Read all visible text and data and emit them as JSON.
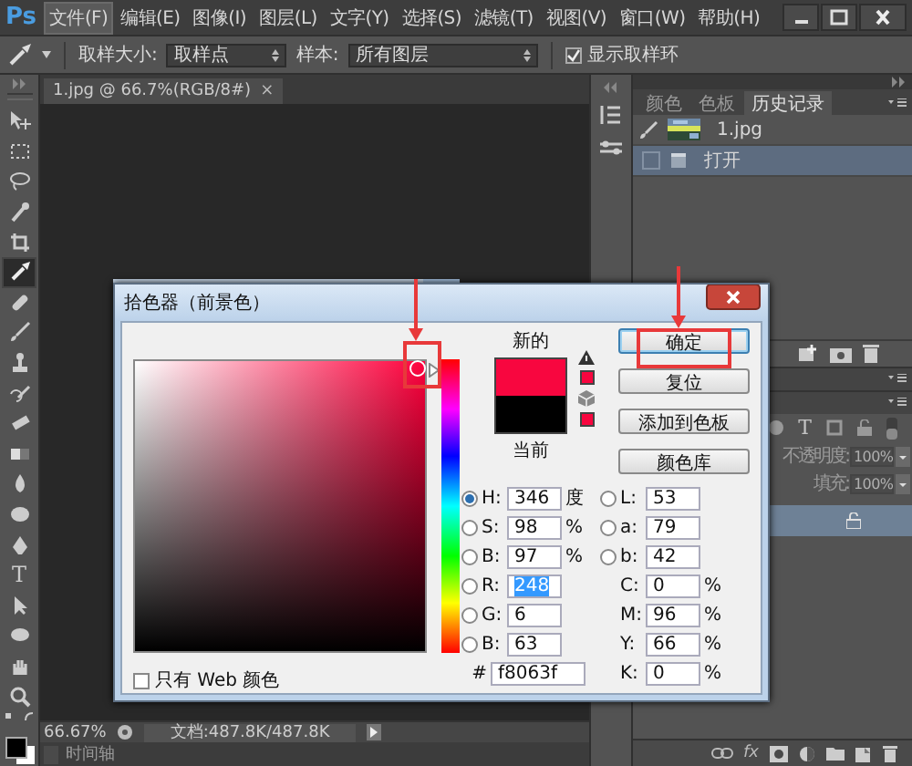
{
  "app": {
    "logo": "Ps"
  },
  "menu": [
    {
      "label": "文件(F)",
      "selected": true
    },
    {
      "label": "编辑(E)",
      "selected": false
    },
    {
      "label": "图像(I)",
      "selected": false
    },
    {
      "label": "图层(L)",
      "selected": false
    },
    {
      "label": "文字(Y)",
      "selected": false
    },
    {
      "label": "选择(S)",
      "selected": false
    },
    {
      "label": "滤镜(T)",
      "selected": false
    },
    {
      "label": "视图(V)",
      "selected": false
    },
    {
      "label": "窗口(W)",
      "selected": false
    },
    {
      "label": "帮助(H)",
      "selected": false
    }
  ],
  "options_bar": {
    "sample_size_label": "取样大小:",
    "sample_size": "取样点",
    "sample_label": "样本:",
    "sample": "所有图层",
    "show_ring": {
      "label": "显示取样环",
      "checked": true
    }
  },
  "tools": [
    {
      "kind": "move",
      "selected": false
    },
    {
      "kind": "marquee",
      "selected": false
    },
    {
      "kind": "lasso",
      "selected": false
    },
    {
      "kind": "quick-select",
      "selected": false
    },
    {
      "kind": "crop",
      "selected": false
    },
    {
      "kind": "eyedropper",
      "selected": true
    },
    {
      "kind": "healing",
      "selected": false
    },
    {
      "kind": "brush",
      "selected": false
    },
    {
      "kind": "stamp",
      "selected": false
    },
    {
      "kind": "history-brush",
      "selected": false
    },
    {
      "kind": "eraser",
      "selected": false
    },
    {
      "kind": "gradient",
      "selected": false
    },
    {
      "kind": "blur",
      "selected": false
    },
    {
      "kind": "dodge",
      "selected": false
    },
    {
      "kind": "pen",
      "selected": false
    },
    {
      "kind": "type",
      "glyph": "T",
      "selected": false
    },
    {
      "kind": "path-select",
      "selected": false
    },
    {
      "kind": "shape",
      "selected": false
    },
    {
      "kind": "hand",
      "selected": false
    },
    {
      "kind": "zoom",
      "selected": false
    }
  ],
  "document_tab": {
    "title": "1.jpg @ 66.7%(RGB/8#)",
    "close": "×"
  },
  "status_bar": {
    "zoom": "66.67%",
    "doc_info": "文档:487.8K/487.8K",
    "timeline": "时间轴"
  },
  "panel_tabs": [
    {
      "label": "颜色",
      "selected": false
    },
    {
      "label": "色板",
      "selected": false
    },
    {
      "label": "历史记录",
      "selected": true
    }
  ],
  "history": [
    {
      "kind": "snapshot",
      "label": "1.jpg",
      "selected": false
    },
    {
      "kind": "step",
      "label": "打开",
      "selected": true
    }
  ],
  "layers": {
    "filter_glyph": "T",
    "filter_toggle": {
      "on": false
    },
    "opacity_label": "不透明度:",
    "opacity": "100%",
    "fill_label": "填充:",
    "fill": "100%",
    "disabled": true,
    "footer_fx": "fx"
  },
  "dialog": {
    "title": "拾色器（前景色）",
    "hue_slider": {
      "level": 0.961
    },
    "swatches": [
      {
        "label": "新的",
        "color": "#f8063f"
      },
      {
        "label": "当前",
        "color": "#000000"
      }
    ],
    "buttons": [
      {
        "label": "确定",
        "default": true
      },
      {
        "label": "复位",
        "default": false
      },
      {
        "label": "添加到色板",
        "default": false
      },
      {
        "label": "颜色库",
        "default": false
      }
    ],
    "fields_left": [
      {
        "kind": "radio",
        "label": "H:",
        "value": "346",
        "unit": "度",
        "selected": true,
        "text_selected": false
      },
      {
        "kind": "radio",
        "label": "S:",
        "value": "98",
        "unit": "%",
        "selected": false,
        "text_selected": false
      },
      {
        "kind": "radio",
        "label": "B:",
        "value": "97",
        "unit": "%",
        "selected": false,
        "text_selected": false
      },
      {
        "kind": "radio",
        "label": "R:",
        "value": "248",
        "selected": false,
        "text_selected": true
      },
      {
        "kind": "radio",
        "label": "G:",
        "value": "6",
        "selected": false,
        "text_selected": false
      },
      {
        "kind": "radio",
        "label": "B:",
        "value": "63",
        "selected": false,
        "text_selected": false
      }
    ],
    "fields_right": [
      {
        "kind": "radio",
        "label": "L:",
        "value": "53",
        "selected": false,
        "text_selected": false
      },
      {
        "kind": "radio",
        "label": "a:",
        "value": "79",
        "selected": false,
        "text_selected": false
      },
      {
        "kind": "radio",
        "label": "b:",
        "value": "42",
        "selected": false,
        "text_selected": false
      },
      {
        "kind": "plain",
        "label": "C:",
        "value": "0",
        "unit": "%",
        "text_selected": false
      },
      {
        "kind": "plain",
        "label": "M:",
        "value": "96",
        "unit": "%",
        "text_selected": false
      },
      {
        "kind": "plain",
        "label": "Y:",
        "value": "66",
        "unit": "%",
        "text_selected": false
      },
      {
        "kind": "plain",
        "label": "K:",
        "value": "0",
        "unit": "%",
        "text_selected": false
      }
    ],
    "hex_label": "#",
    "hex": "f8063f",
    "web_only": {
      "label": "只有 Web 颜色",
      "checked": false
    }
  }
}
